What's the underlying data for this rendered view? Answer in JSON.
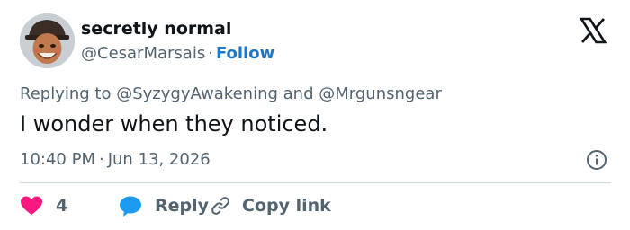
{
  "author": {
    "display_name": "secretly normal",
    "handle": "@CesarMarsais",
    "separator": "·",
    "follow_label": "Follow"
  },
  "reply_context": {
    "prefix": "Replying to",
    "mention_1": "@SyzygyAwakening",
    "conjunction": "and",
    "mention_2": "@Mrgunsngear"
  },
  "tweet": {
    "text": "I wonder when they noticed.",
    "time": "10:40 PM",
    "separator": "·",
    "date": "Jun 13, 2026"
  },
  "actions": {
    "like_count": "4",
    "reply_label": "Reply",
    "copy_label": "Copy link"
  },
  "icons": {
    "logo": "x-logo-icon",
    "info": "info-icon",
    "like": "heart-icon",
    "reply": "speech-bubble-icon",
    "copy": "link-icon"
  },
  "colors": {
    "heart": "#f91880",
    "reply_bubble": "#1d9bf0",
    "follow": "#1d77c4",
    "muted": "#536471",
    "text": "#0f1419"
  }
}
